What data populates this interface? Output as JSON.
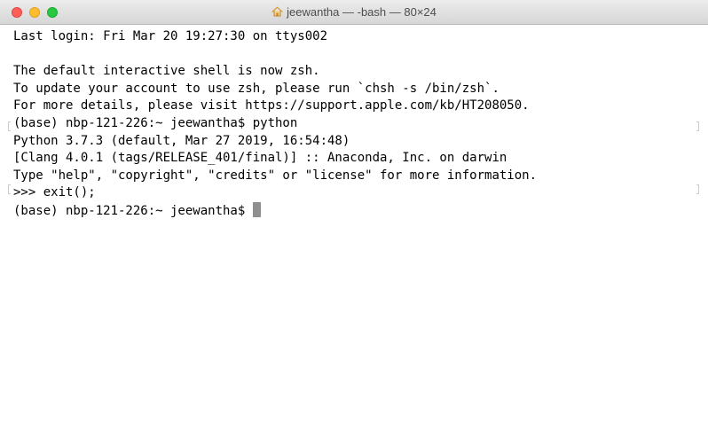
{
  "window": {
    "title": "jeewantha — -bash — 80×24",
    "title_icon": "home-icon"
  },
  "terminal": {
    "lines": [
      "Last login: Fri Mar 20 19:27:30 on ttys002",
      "",
      "The default interactive shell is now zsh.",
      "To update your account to use zsh, please run `chsh -s /bin/zsh`.",
      "For more details, please visit https://support.apple.com/kb/HT208050.",
      "(base) nbp-121-226:~ jeewantha$ python",
      "Python 3.7.3 (default, Mar 27 2019, 16:54:48)",
      "[Clang 4.0.1 (tags/RELEASE_401/final)] :: Anaconda, Inc. on darwin",
      "Type \"help\", \"copyright\", \"credits\" or \"license\" for more information.",
      ">>> exit();",
      "(base) nbp-121-226:~ jeewantha$ "
    ]
  },
  "colors": {
    "close": "#fe5f57",
    "minimize": "#febc2e",
    "zoom": "#28c840",
    "cursor": "#8f8f8f"
  }
}
